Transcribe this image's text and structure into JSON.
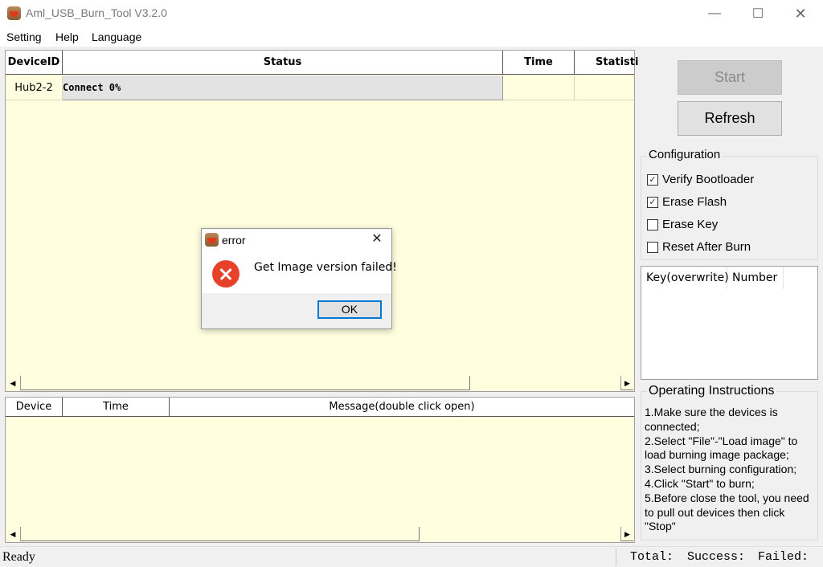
{
  "window": {
    "title": "Aml_USB_Burn_Tool V3.2.0",
    "minimize": "—",
    "maximize": "☐",
    "close": "✕"
  },
  "menu": [
    "Setting",
    "Help",
    "Language"
  ],
  "device_grid": {
    "columns": [
      "DeviceID",
      "Status",
      "Time",
      "Statistic"
    ],
    "rows": [
      {
        "device_id": "Hub2-2",
        "status": "Connect 0%",
        "time": "",
        "statistic": ""
      }
    ]
  },
  "message_grid": {
    "columns": [
      "Device",
      "Time",
      "Message(double click open)"
    ]
  },
  "buttons": {
    "start": "Start",
    "refresh": "Refresh"
  },
  "configuration": {
    "title": "Configuration",
    "options": [
      {
        "label": "Verify Bootloader",
        "checked": true
      },
      {
        "label": "Erase Flash",
        "checked": true
      },
      {
        "label": "Erase Key",
        "checked": false
      },
      {
        "label": "Reset After Burn",
        "checked": false
      }
    ]
  },
  "key_list": {
    "columns": [
      "Key(overwrite)",
      "Number"
    ]
  },
  "instructions": {
    "title": "Operating Instructions",
    "text": "1.Make sure the devices is connected;\n2.Select \"File\"-\"Load image\" to load burning image package;\n3.Select burning configuration;\n4.Click \"Start\" to burn;\n5.Before close the tool, you need to pull out devices then click \"Stop\""
  },
  "status_bar": {
    "status": "Ready",
    "total": "Total:",
    "success": "Success:",
    "failed": "Failed:"
  },
  "dialog": {
    "title": "error",
    "message": "Get Image version failed!",
    "ok": "OK",
    "close": "✕"
  },
  "icons": {
    "checked": "✓",
    "left_arrow": "◀",
    "right_arrow": "▶"
  }
}
